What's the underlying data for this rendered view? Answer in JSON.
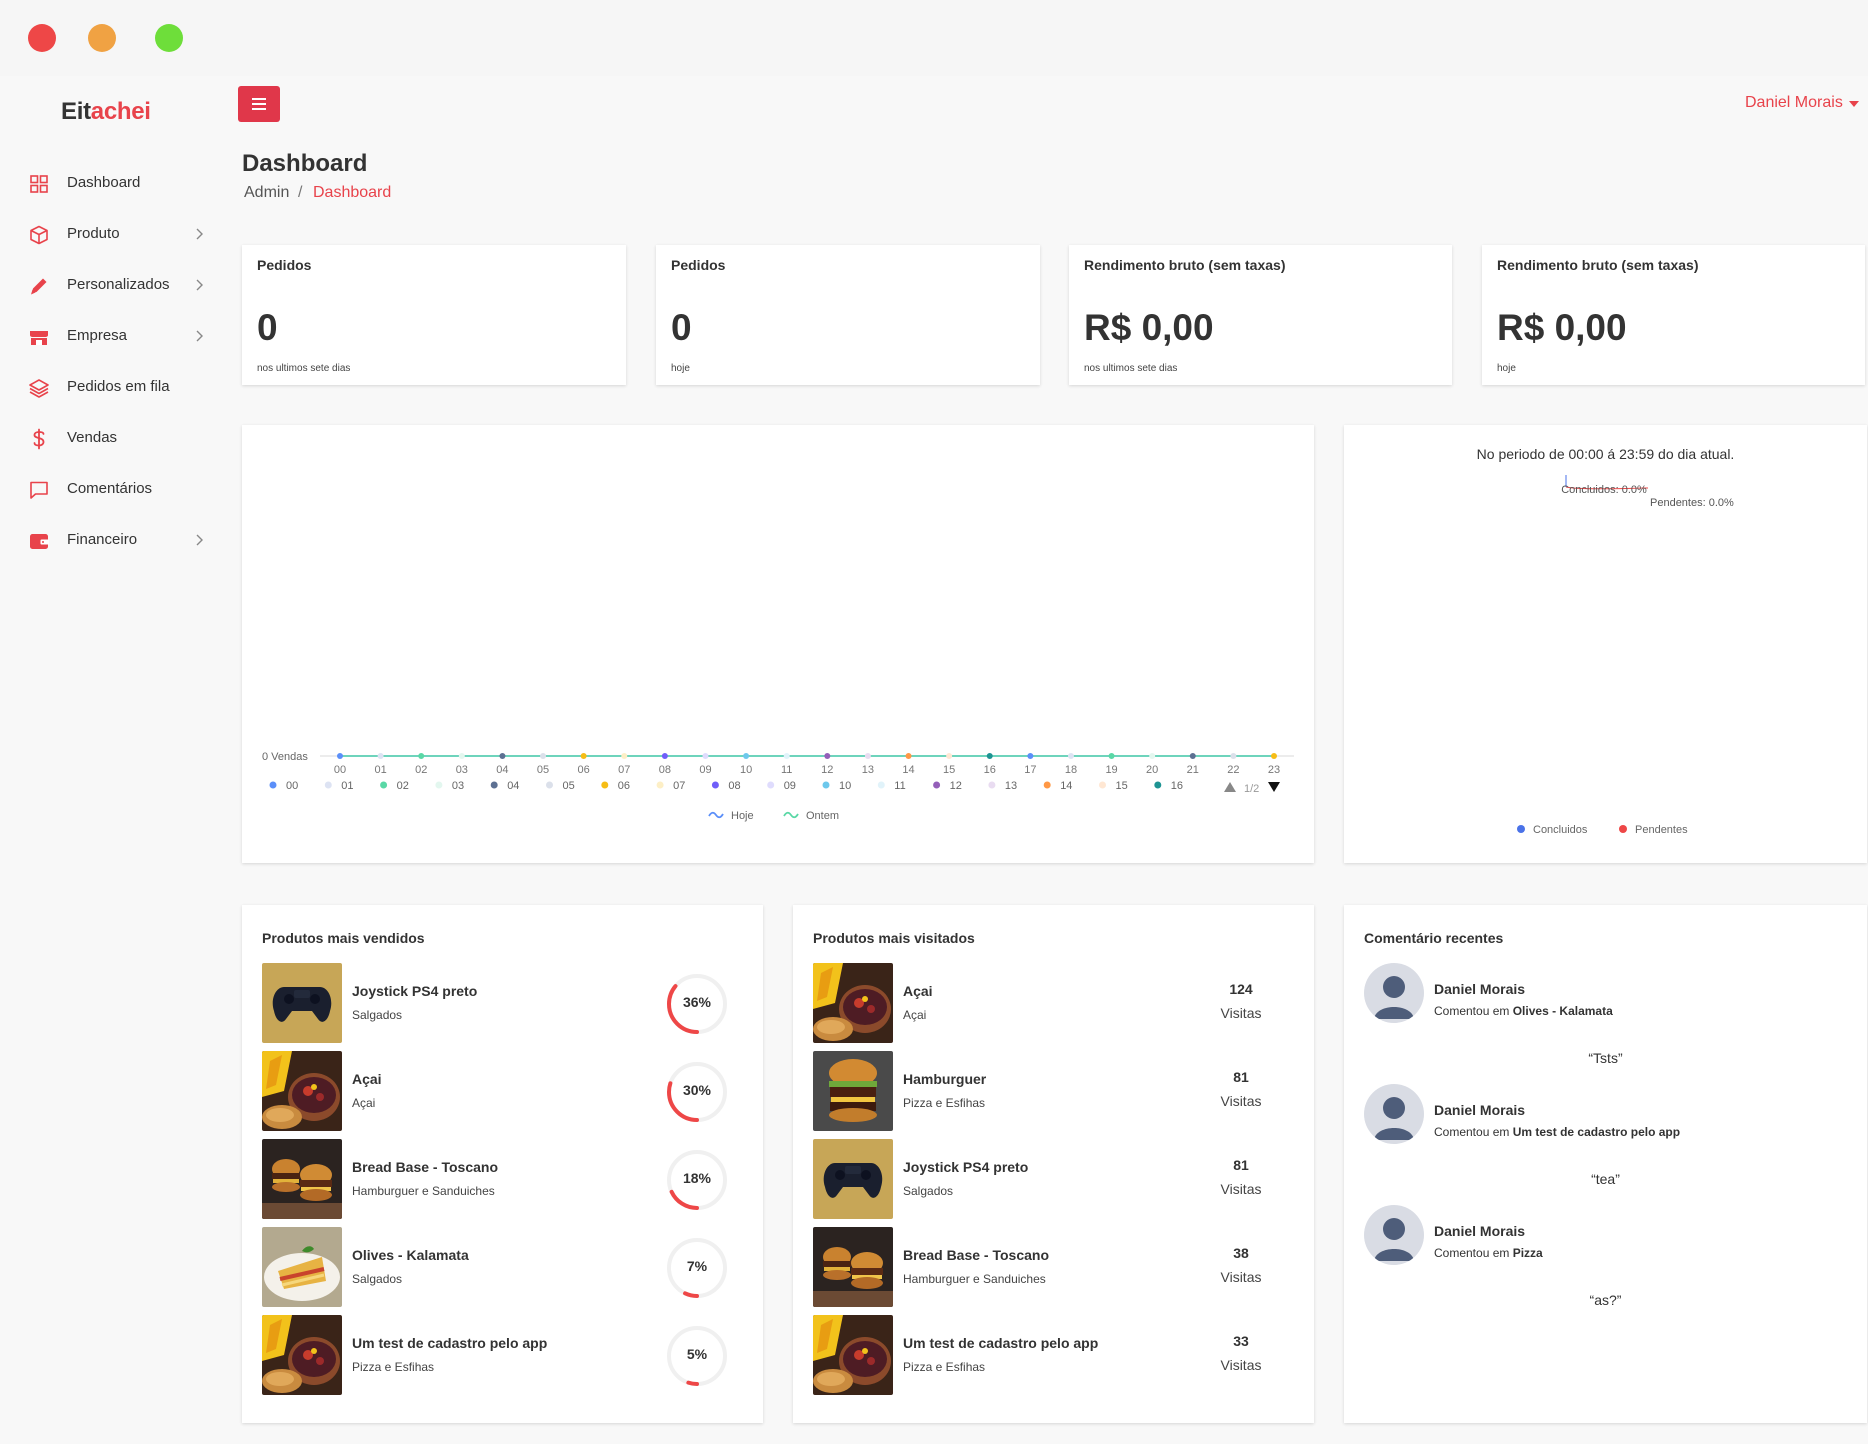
{
  "app": {
    "logo_prefix": "Eit",
    "logo_accent": "achei",
    "accent_color": "#e8434b"
  },
  "user": {
    "name": "Daniel Morais"
  },
  "sidebar": {
    "items": [
      {
        "label": "Dashboard",
        "icon": "grid-icon",
        "has_submenu": false
      },
      {
        "label": "Produto",
        "icon": "box-icon",
        "has_submenu": true
      },
      {
        "label": "Personalizados",
        "icon": "pencil-icon",
        "has_submenu": true
      },
      {
        "label": "Empresa",
        "icon": "store-icon",
        "has_submenu": true
      },
      {
        "label": "Pedidos em fila",
        "icon": "layers-icon",
        "has_submenu": false
      },
      {
        "label": "Vendas",
        "icon": "dollar-icon",
        "has_submenu": false
      },
      {
        "label": "Comentários",
        "icon": "message-icon",
        "has_submenu": false
      },
      {
        "label": "Financeiro",
        "icon": "wallet-icon",
        "has_submenu": true
      }
    ]
  },
  "header": {
    "title": "Dashboard",
    "breadcrumb_root": "Admin",
    "breadcrumb_sep": "/",
    "breadcrumb_current": "Dashboard"
  },
  "stats": [
    {
      "title": "Pedidos",
      "value": "0",
      "sub": "nos ultimos sete dias"
    },
    {
      "title": "Pedidos",
      "value": "0",
      "sub": "hoje"
    },
    {
      "title": "Rendimento bruto (sem taxas)",
      "value": "R$ 0,00",
      "sub": "nos ultimos sete dias"
    },
    {
      "title": "Rendimento bruto (sem taxas)",
      "value": "R$ 0,00",
      "sub": "hoje"
    }
  ],
  "chart_data": [
    {
      "type": "line",
      "ylabel_text": "0 Vendas",
      "x": [
        "00",
        "01",
        "02",
        "03",
        "04",
        "05",
        "06",
        "07",
        "08",
        "09",
        "10",
        "11",
        "12",
        "13",
        "14",
        "15",
        "16",
        "17",
        "18",
        "19",
        "20",
        "21",
        "22",
        "23"
      ],
      "series": [
        {
          "name": "Hoje",
          "values": [
            0,
            0,
            0,
            0,
            0,
            0,
            0,
            0,
            0,
            0,
            0,
            0,
            0,
            0,
            0,
            0,
            0,
            0,
            0,
            0,
            0,
            0,
            0,
            0
          ]
        },
        {
          "name": "Ontem",
          "values": [
            0,
            0,
            0,
            0,
            0,
            0,
            0,
            0,
            0,
            0,
            0,
            0,
            0,
            0,
            0,
            0,
            0,
            0,
            0,
            0,
            0,
            0,
            0,
            0
          ]
        }
      ],
      "point_legend": [
        "00",
        "01",
        "02",
        "03",
        "04",
        "05",
        "06",
        "07",
        "08",
        "09",
        "10",
        "11",
        "12",
        "13",
        "14",
        "15",
        "16"
      ],
      "point_colors": [
        "#5b8ff9",
        "#dde3f3",
        "#5ad8a6",
        "#e3f7ef",
        "#5d7092",
        "#dbe0ea",
        "#f6bd16",
        "#fdefc6",
        "#6f5ef9",
        "#dfdcfd",
        "#6dc8ec",
        "#e1f3fa",
        "#945fb9",
        "#e9dcf1",
        "#ff9845",
        "#ffe7d3",
        "#1e9493"
      ],
      "legend_page": "1/2",
      "series_colors": [
        "#5b8ff9",
        "#5ad8a6"
      ]
    },
    {
      "type": "pie",
      "title": "No periodo de 00:00 á 23:59 do dia atual.",
      "slices": [
        {
          "name": "Concluidos",
          "value": 0.0,
          "label": "Concluidos: 0.0%",
          "color": "#4a72e8"
        },
        {
          "name": "Pendentes",
          "value": 0.0,
          "label": "Pendentes: 0.0%",
          "color": "#ee4747"
        }
      ]
    }
  ],
  "top_sold": {
    "title": "Produtos mais vendidos",
    "items": [
      {
        "name": "Joystick PS4 preto",
        "category": "Salgados",
        "percent": 36,
        "percent_label": "36%",
        "thumb": "joystick"
      },
      {
        "name": "Açai",
        "category": "Açai",
        "percent": 30,
        "percent_label": "30%",
        "thumb": "acai"
      },
      {
        "name": "Bread Base - Toscano",
        "category": "Hamburguer e Sanduiches",
        "percent": 18,
        "percent_label": "18%",
        "thumb": "burger"
      },
      {
        "name": "Olives - Kalamata",
        "category": "Salgados",
        "percent": 7,
        "percent_label": "7%",
        "thumb": "pasta"
      },
      {
        "name": "Um test de cadastro pelo app",
        "category": "Pizza e Esfihas",
        "percent": 5,
        "percent_label": "5%",
        "thumb": "acai"
      }
    ]
  },
  "top_visited": {
    "title": "Produtos mais visitados",
    "items": [
      {
        "name": "Açai",
        "category": "Açai",
        "count": "124",
        "count_label": "Visitas",
        "thumb": "acai"
      },
      {
        "name": "Hamburguer",
        "category": "Pizza e Esfihas",
        "count": "81",
        "count_label": "Visitas",
        "thumb": "burger2"
      },
      {
        "name": "Joystick PS4 preto",
        "category": "Salgados",
        "count": "81",
        "count_label": "Visitas",
        "thumb": "joystick"
      },
      {
        "name": "Bread Base - Toscano",
        "category": "Hamburguer e Sanduiches",
        "count": "38",
        "count_label": "Visitas",
        "thumb": "burger"
      },
      {
        "name": "Um test de cadastro pelo app",
        "category": "Pizza e Esfihas",
        "count": "33",
        "count_label": "Visitas",
        "thumb": "acai"
      }
    ]
  },
  "comments": {
    "title": "Comentário recentes",
    "items": [
      {
        "author": "Daniel Morais",
        "prefix": "Comentou em",
        "target": "Olives - Kalamata",
        "text": "“Tsts”"
      },
      {
        "author": "Daniel Morais",
        "prefix": "Comentou em",
        "target": "Um test de cadastro pelo app",
        "text": "“tea”"
      },
      {
        "author": "Daniel Morais",
        "prefix": "Comentou em",
        "target": "Pizza",
        "text": "“as?”"
      }
    ]
  }
}
